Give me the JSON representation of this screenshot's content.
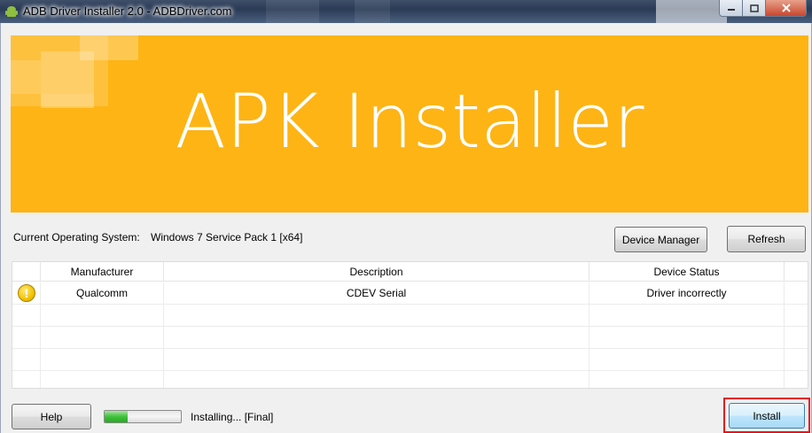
{
  "window": {
    "title": "ADB Driver Installer 2.0 - ADBDriver.com"
  },
  "banner": {
    "title": "APK Installer",
    "color": "#feb414"
  },
  "system": {
    "os_label": "Current Operating System:",
    "os_value": "Windows 7 Service Pack 1 [x64]"
  },
  "buttons": {
    "device_manager": "Device Manager",
    "refresh": "Refresh",
    "help": "Help",
    "install": "Install"
  },
  "table": {
    "headers": [
      "Manufacturer",
      "Description",
      "Device Status"
    ],
    "rows": [
      {
        "icon": "warning-icon",
        "manufacturer": "Qualcomm",
        "description": "CDEV Serial",
        "status": "Driver incorrectly"
      }
    ]
  },
  "status": {
    "text": "Installing... [Final]",
    "progress": 0.3,
    "progress_color": "#3fc13a"
  }
}
